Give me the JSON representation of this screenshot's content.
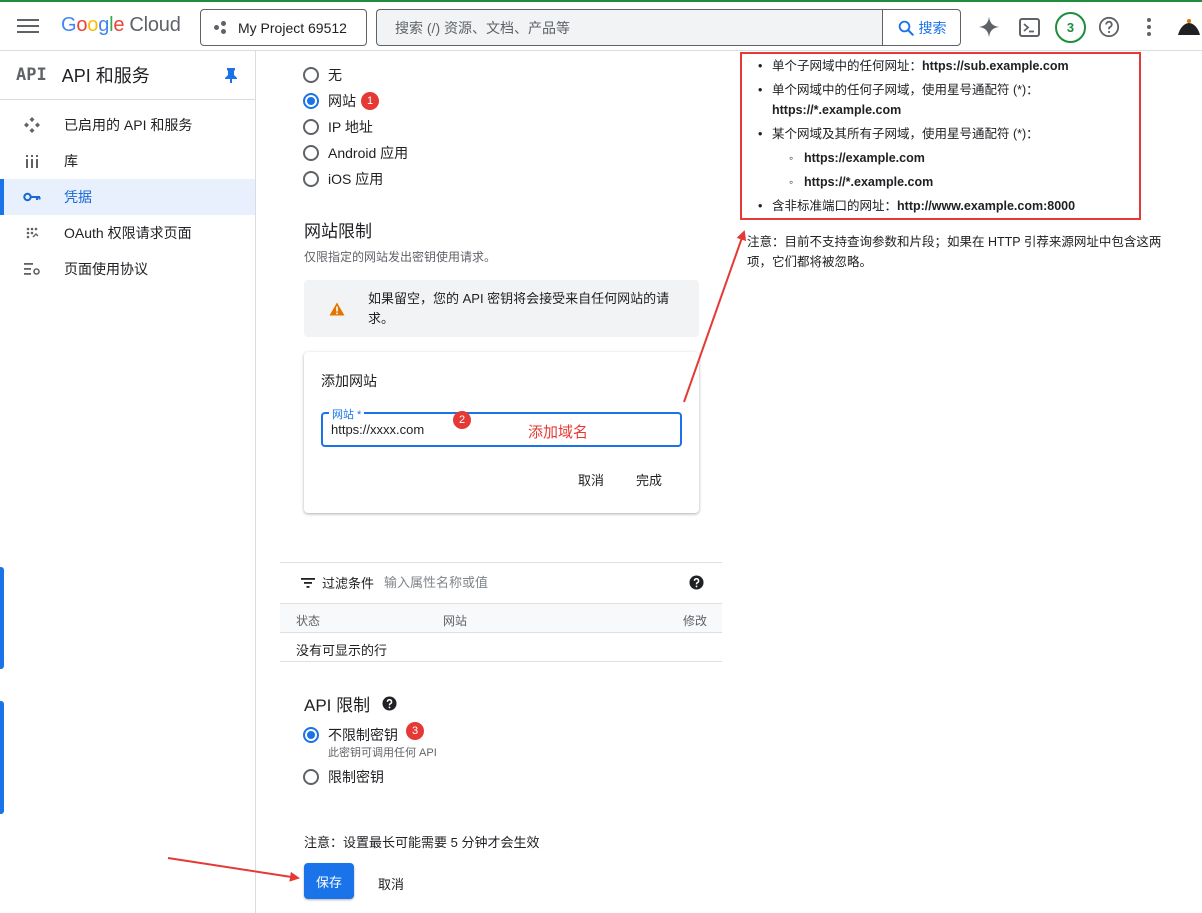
{
  "topbar": {
    "logo_google": [
      "G",
      "o",
      "o",
      "g",
      "l",
      "e"
    ],
    "logo_cloud": "Cloud",
    "project_name": "My Project 69512",
    "search_placeholder": "搜索 (/) 资源、文档、产品等",
    "search_button": "搜索",
    "notifications_count": "3",
    "icons": [
      "menu-icon",
      "project-icon",
      "search-icon",
      "gemini-icon",
      "cloud-shell-icon",
      "help-icon",
      "more-vert-icon",
      "avatar"
    ]
  },
  "sidebar": {
    "api_mark": "API",
    "title": "API 和服务",
    "items": [
      {
        "label": "已启用的 API 和服务",
        "icon": "apis-icon",
        "active": false
      },
      {
        "label": "库",
        "icon": "library-icon",
        "active": false
      },
      {
        "label": "凭据",
        "icon": "key-icon",
        "active": true
      },
      {
        "label": "OAuth 权限请求页面",
        "icon": "oauth-icon",
        "active": false
      },
      {
        "label": "页面使用协议",
        "icon": "settings-list-icon",
        "active": false
      }
    ]
  },
  "app_restrictions": {
    "options": [
      {
        "label": "无",
        "selected": false
      },
      {
        "label": "网站",
        "selected": true,
        "badge": "1"
      },
      {
        "label": "IP 地址",
        "selected": false
      },
      {
        "label": "Android 应用",
        "selected": false
      },
      {
        "label": "iOS 应用",
        "selected": false
      }
    ]
  },
  "website_restrictions": {
    "title": "网站限制",
    "subtitle": "仅限指定的网站发出密钥使用请求。",
    "warning": "如果留空，您的 API 密钥将会接受来自任何网站的请求。",
    "card": {
      "title": "添加网站",
      "field_label": "网站 *",
      "field_value": "https://xxxx.com",
      "badge": "2",
      "annotation": "添加域名",
      "cancel": "取消",
      "done": "完成"
    }
  },
  "table": {
    "filter_label": "过滤条件",
    "filter_placeholder": "输入属性名称或值",
    "columns": [
      "状态",
      "网站",
      "修改"
    ],
    "empty": "没有可显示的行"
  },
  "api_restrictions": {
    "title": "API 限制",
    "options": [
      {
        "label": "不限制密钥",
        "selected": true,
        "badge": "3",
        "sub": "此密钥可调用任何 API"
      },
      {
        "label": "限制密钥",
        "selected": false
      }
    ]
  },
  "footer": {
    "note": "注意：设置最长可能需要 5 分钟才会生效",
    "save": "保存",
    "cancel": "取消"
  },
  "info_box": {
    "items": [
      {
        "text": "单个子网域中的任何网址：",
        "bold": "https://sub.example.com"
      },
      {
        "text": "单个网域中的任何子网域，使用星号通配符 (*)：",
        "bold": "https://*.example.com"
      },
      {
        "text": "某个网域及其所有子网域，使用星号通配符 (*)：",
        "bold": ""
      },
      {
        "sub": true,
        "bold": "https://example.com"
      },
      {
        "sub": true,
        "bold": "https://*.example.com"
      },
      {
        "text": "含非标准端口的网址：",
        "bold": "http://www.example.com:8000"
      }
    ],
    "note": "注意：目前不支持查询参数和片段；如果在 HTTP 引荐来源网址中包含这两项，它们都将被忽略。"
  },
  "colors": {
    "accent": "#1a73e8",
    "annotation_red": "#e53935",
    "warning_orange": "#e37400",
    "green": "#1e8e3e"
  }
}
